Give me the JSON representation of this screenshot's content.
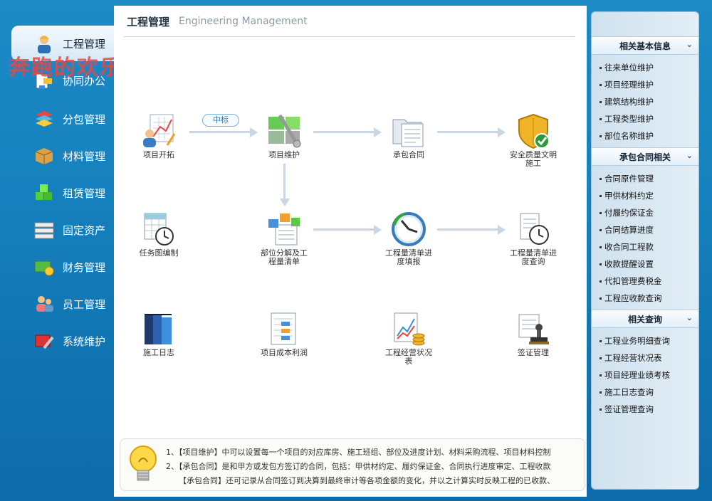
{
  "watermark": "奔跑的欢乐豆",
  "sidebar": {
    "items": [
      {
        "label": "工程管理",
        "icon": "engineer-icon",
        "active": true
      },
      {
        "label": "协同办公",
        "icon": "office-icon"
      },
      {
        "label": "分包管理",
        "icon": "layers-icon"
      },
      {
        "label": "材料管理",
        "icon": "box-icon"
      },
      {
        "label": "租赁管理",
        "icon": "cubes-icon"
      },
      {
        "label": "固定资产",
        "icon": "server-icon"
      },
      {
        "label": "财务管理",
        "icon": "money-icon"
      },
      {
        "label": "员工管理",
        "icon": "users-icon"
      },
      {
        "label": "系统维护",
        "icon": "tools-icon"
      }
    ]
  },
  "main": {
    "title": "工程管理",
    "subtitle": "Engineering Management",
    "flow_tag": "中标",
    "nodes": [
      {
        "label": "项目开拓",
        "icon": "project-expand-icon"
      },
      {
        "label": "项目维护",
        "icon": "project-maintain-icon"
      },
      {
        "label": "承包合同",
        "icon": "contract-folder-icon"
      },
      {
        "label": "安全质量文明施工",
        "icon": "safety-shield-icon"
      },
      {
        "label": "任务图编制",
        "icon": "task-chart-icon"
      },
      {
        "label": "部位分解及工程量清单",
        "icon": "decompose-icon"
      },
      {
        "label": "工程量清单进度填报",
        "icon": "progress-clock-icon"
      },
      {
        "label": "工程量清单进度查询",
        "icon": "progress-query-icon"
      },
      {
        "label": "施工日志",
        "icon": "log-books-icon"
      },
      {
        "label": "项目成本利润",
        "icon": "cost-profit-icon"
      },
      {
        "label": "工程经营状况表",
        "icon": "business-chart-icon"
      },
      {
        "label": "签证管理",
        "icon": "stamp-icon"
      }
    ],
    "tips": [
      "1、【项目维护】中可以设置每一个项目的对应库房、施工班组、部位及进度计划、材料采购流程、项目材料控制",
      "2、【承包合同】是和甲方或发包方签订的合同，包括：甲供材约定、履约保证金、合同执行进度审定、工程收款",
      "【承包合同】还可记录从合同签订到决算到最终审计等各项金额的变化，并以之计算实时反映工程的已收款、"
    ]
  },
  "right": {
    "sections": [
      {
        "title": "相关基本信息",
        "items": [
          "往来单位维护",
          "项目经理维护",
          "建筑结构维护",
          "工程类型维护",
          "部位名称维护"
        ]
      },
      {
        "title": "承包合同相关",
        "items": [
          "合同原件管理",
          "甲供材料约定",
          "付履约保证金",
          "合同结算进度",
          "收合同工程款",
          "收款提醒设置",
          "代扣管理费税金",
          "工程应收款查询"
        ]
      },
      {
        "title": "相关查询",
        "items": [
          "工程业务明细查询",
          "工程经营状况表",
          "项目经理业绩考核",
          "施工日志查询",
          "签证管理查询"
        ]
      }
    ]
  },
  "colors": {
    "background": "#1580bd",
    "panel": "#ffffff",
    "arrow": "#c9d6e4",
    "watermark": "#e64646"
  }
}
